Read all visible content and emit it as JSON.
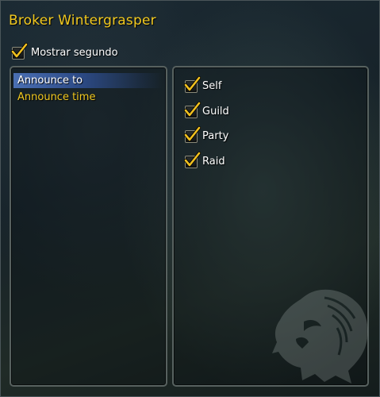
{
  "window": {
    "title": "Broker Wintergrasper"
  },
  "options": {
    "show_seconds": {
      "label": "Mostrar segundo",
      "checked": true
    }
  },
  "tree": {
    "items": [
      {
        "label": "Announce to",
        "selected": true
      },
      {
        "label": "Announce time",
        "selected": false
      }
    ]
  },
  "announce_to": {
    "checkboxes": [
      {
        "label": "Self",
        "checked": true
      },
      {
        "label": "Guild",
        "checked": true
      },
      {
        "label": "Party",
        "checked": true
      },
      {
        "label": "Raid",
        "checked": true
      }
    ]
  },
  "colors": {
    "title_gold": "#f2c91f",
    "selection_blue": "#3a5fa0",
    "checkmark_gold": "#f0c020",
    "text_white": "#ffffff"
  },
  "icons": {
    "checkmark": "checkmark-icon",
    "watermark": "lion-head-emblem-icon"
  }
}
